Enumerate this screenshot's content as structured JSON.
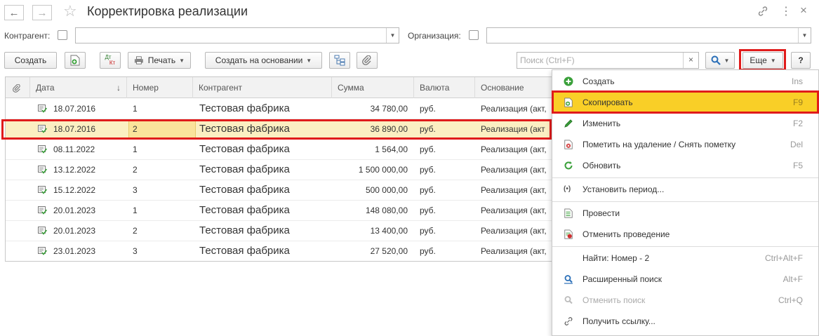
{
  "window": {
    "title": "Корректировка реализации"
  },
  "filters": {
    "kontragent_label": "Контрагент:",
    "organization_label": "Организация:"
  },
  "toolbar": {
    "create_label": "Создать",
    "dt_label": "Дт",
    "kt_label": "Кт",
    "print_label": "Печать",
    "create_based_label": "Создать на основании",
    "search_placeholder": "Поиск (Ctrl+F)",
    "more_label": "Еще",
    "help_label": "?"
  },
  "table": {
    "columns": [
      "Дата",
      "Номер",
      "Контрагент",
      "Сумма",
      "Валюта",
      "Основание"
    ],
    "sort_arrow": "↓",
    "rows": [
      {
        "date": "18.07.2016",
        "number": "1",
        "contractor": "Тестовая фабрика",
        "sum": "34 780,00",
        "currency": "руб.",
        "basis": "Реализация (акт,"
      },
      {
        "date": "18.07.2016",
        "number": "2",
        "contractor": "Тестовая фабрика",
        "sum": "36 890,00",
        "currency": "руб.",
        "basis": "Реализация (акт"
      },
      {
        "date": "08.11.2022",
        "number": "1",
        "contractor": "Тестовая фабрика",
        "sum": "1 564,00",
        "currency": "руб.",
        "basis": "Реализация (акт,"
      },
      {
        "date": "13.12.2022",
        "number": "2",
        "contractor": "Тестовая фабрика",
        "sum": "1 500 000,00",
        "currency": "руб.",
        "basis": "Реализация (акт,"
      },
      {
        "date": "15.12.2022",
        "number": "3",
        "contractor": "Тестовая фабрика",
        "sum": "500 000,00",
        "currency": "руб.",
        "basis": "Реализация (акт,"
      },
      {
        "date": "20.01.2023",
        "number": "1",
        "contractor": "Тестовая фабрика",
        "sum": "148 080,00",
        "currency": "руб.",
        "basis": "Реализация (акт,"
      },
      {
        "date": "20.01.2023",
        "number": "2",
        "contractor": "Тестовая фабрика",
        "sum": "13 400,00",
        "currency": "руб.",
        "basis": "Реализация (акт,"
      },
      {
        "date": "23.01.2023",
        "number": "3",
        "contractor": "Тестовая фабрика",
        "sum": "27 520,00",
        "currency": "руб.",
        "basis": "Реализация (акт,"
      }
    ]
  },
  "menu": {
    "items": [
      {
        "label": "Создать",
        "shortcut": "Ins"
      },
      {
        "label": "Скопировать",
        "shortcut": "F9"
      },
      {
        "label": "Изменить",
        "shortcut": "F2"
      },
      {
        "label": "Пометить на удаление / Снять пометку",
        "shortcut": "Del"
      },
      {
        "label": "Обновить",
        "shortcut": "F5"
      },
      {
        "label": "Установить период...",
        "shortcut": ""
      },
      {
        "label": "Провести",
        "shortcut": ""
      },
      {
        "label": "Отменить проведение",
        "shortcut": ""
      },
      {
        "label": "Найти: Номер - 2",
        "shortcut": "Ctrl+Alt+F"
      },
      {
        "label": "Расширенный поиск",
        "shortcut": "Alt+F"
      },
      {
        "label": "Отменить поиск",
        "shortcut": "Ctrl+Q"
      },
      {
        "label": "Получить ссылку...",
        "shortcut": ""
      }
    ]
  },
  "colors": {
    "highlight": "#f9cf27",
    "selected_row": "#fbefc2",
    "annotation_red": "#e01b1b",
    "accent_green": "#3aa03a"
  }
}
